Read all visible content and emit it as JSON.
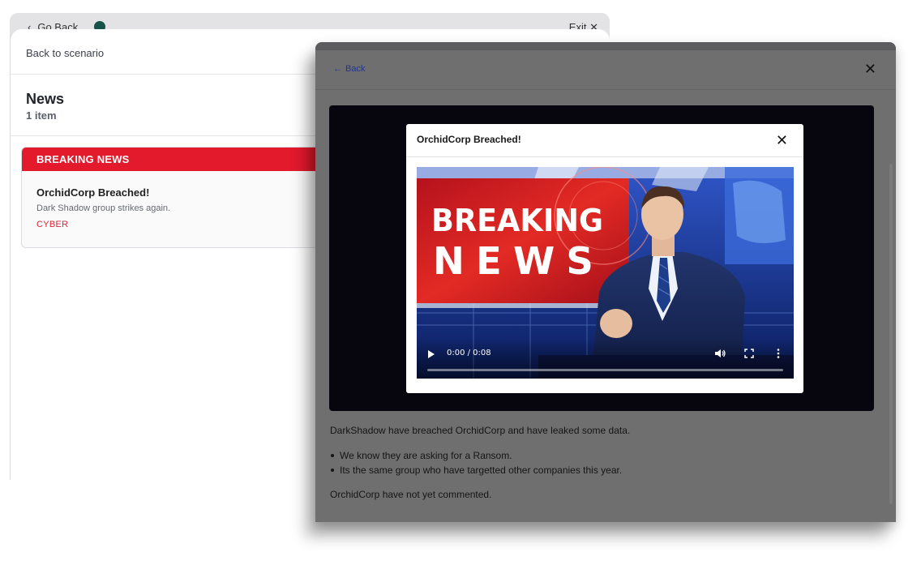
{
  "background_app": {
    "go_back_label": "Go Back",
    "exit_label": "Exit",
    "status_color": "#17524a"
  },
  "left_panel": {
    "back_label": "Back to scenario",
    "title": "News",
    "count": "1 item",
    "card": {
      "banner": "BREAKING NEWS",
      "headline": "OrchidCorp Breached!",
      "subtitle": "Dark Shadow group strikes again.",
      "tag": "CYBER",
      "banner_color": "#e21a2c"
    }
  },
  "article": {
    "back_label": "Back",
    "intro": "DarkShadow have breached OrchidCorp and have leaked some data.",
    "bullets": [
      "We know they are asking for a Ransom.",
      "Its the same group who have targetted other companies this year."
    ],
    "closing": "OrchidCorp have not yet commented."
  },
  "video_dialog": {
    "title": "OrchidCorp Breached!",
    "thumbnail": {
      "line1": "BREAKING",
      "line2": "NEWS"
    },
    "player": {
      "time": "0:00 / 0:08",
      "progress": 0
    }
  }
}
